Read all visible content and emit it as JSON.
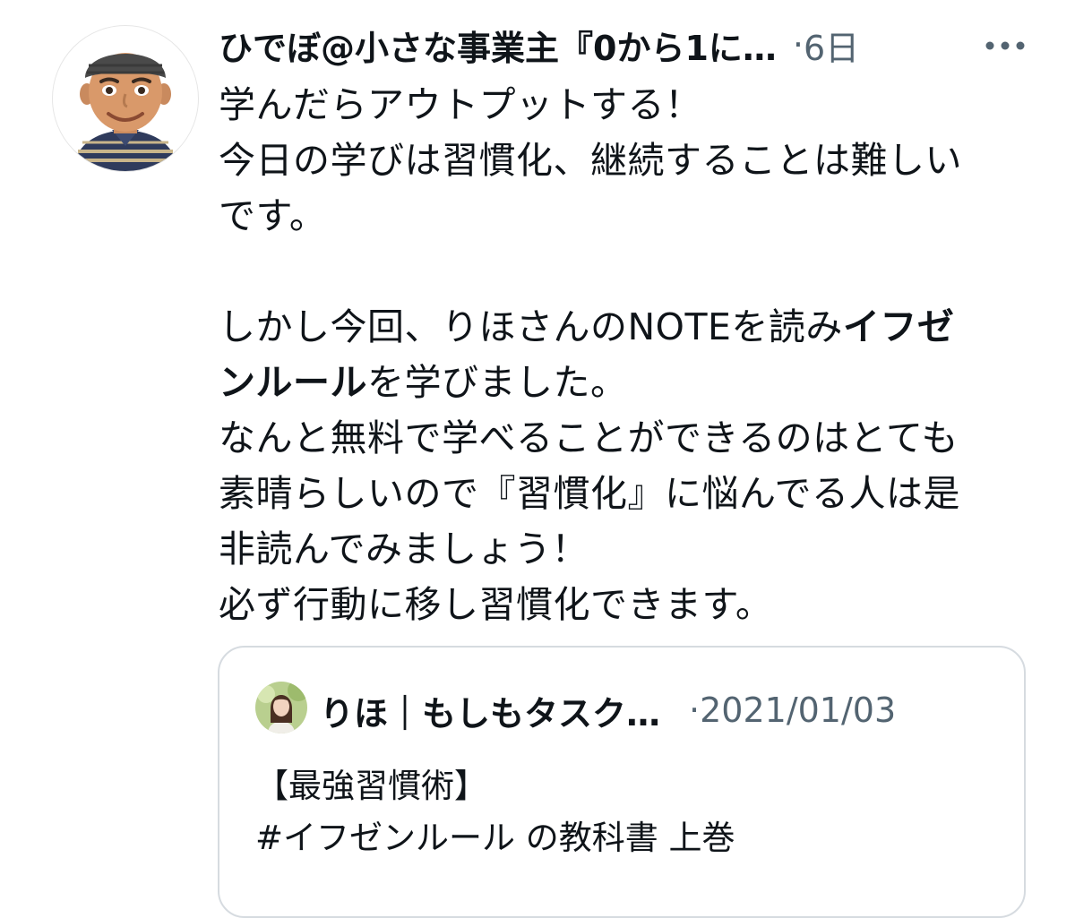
{
  "tweet": {
    "author": {
      "display_name": "ひでぼ@小さな事業主『0から1に…",
      "avatar_icon": "memoji-avatar-icon"
    },
    "separator": "·",
    "time": "6日",
    "more_icon": "more-horizontal-icon",
    "text_lines": [
      "学んだらアウトプットする！",
      "今日の学びは習慣化、継続することは難しい",
      "です。",
      "",
      {
        "before": "しかし今回、りほさんのNOTEを読み",
        "bold": "イフゼ",
        "after": ""
      },
      {
        "before": "",
        "bold": "ンルール",
        "after": "を学びました。"
      },
      "なんと無料で学べることができるのはとても",
      "素晴らしいので『習慣化』に悩んでる人は是",
      "非読んでみましょう！",
      "必ず行動に移し習慣化できます。"
    ],
    "quote": {
      "author": {
        "display_name": "りほ｜もしもタスク…",
        "avatar_icon": "profile-photo-icon"
      },
      "separator": "·",
      "date": "2021/01/03",
      "text_lines": [
        "【最強習慣術】",
        "#イフゼンルール の教科書 上巻"
      ]
    }
  },
  "colors": {
    "text_primary": "#0f1419",
    "text_secondary": "#536471",
    "border": "#d6dbe0"
  }
}
